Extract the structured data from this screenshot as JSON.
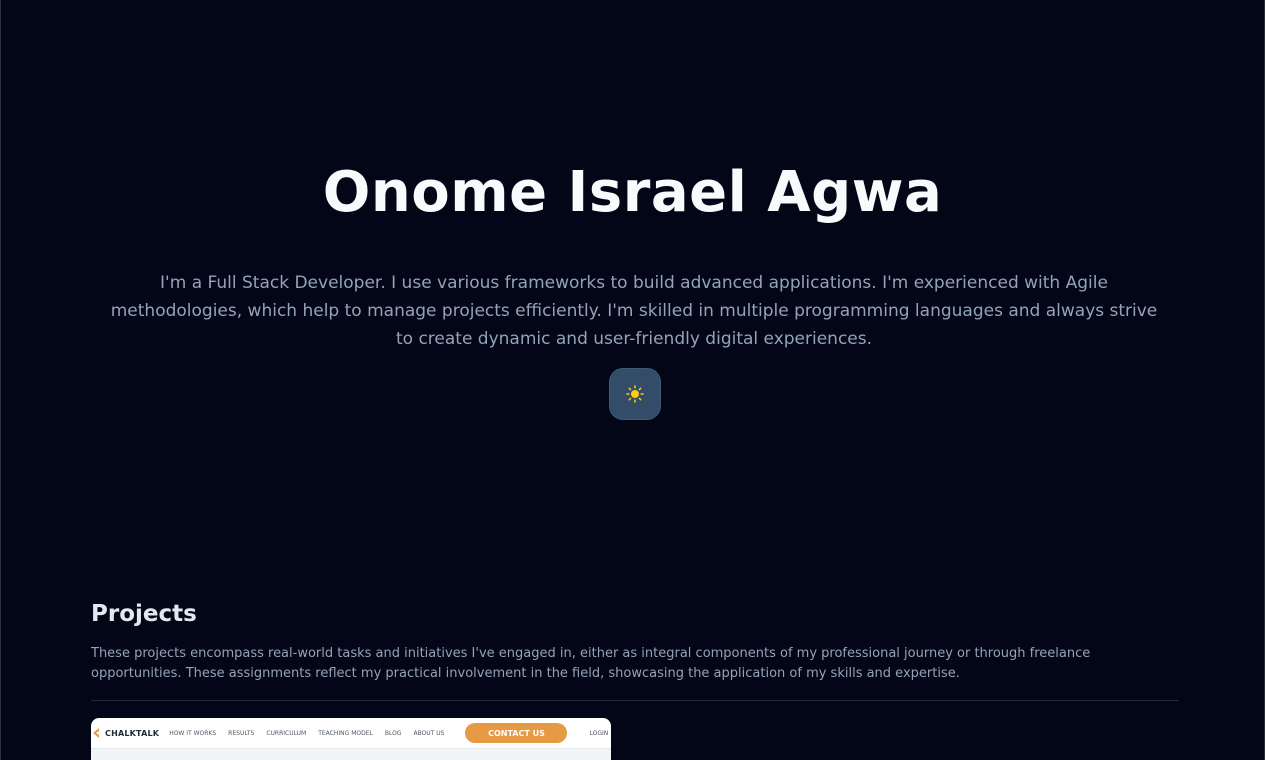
{
  "hero": {
    "name": "Onome Israel Agwa",
    "description": "I'm a Full Stack Developer. I use various frameworks to build advanced applications. I'm experienced with Agile methodologies, which help to manage projects efficiently. I'm skilled in multiple programming languages and always strive to create dynamic and user-friendly digital experiences."
  },
  "theme_toggle": {
    "icon": "sun-icon",
    "icon_color": "#facc15"
  },
  "projects": {
    "title": "Projects",
    "description": "These projects encompass real-world tasks and initiatives I've engaged in, either as integral components of my professional journey or through freelance opportunities. These assignments reflect my practical involvement in the field, showcasing the application of my skills and expertise.",
    "cards": [
      {
        "preview": {
          "logo": "CHALKTALK",
          "nav": [
            "HOW IT WORKS",
            "RESULTS",
            "CURRICULUM",
            "TEACHING MODEL",
            "BLOG",
            "ABOUT US"
          ],
          "cta": "CONTACT US",
          "login": "LOGIN",
          "accent": "#e69a43"
        }
      }
    ]
  },
  "colors": {
    "background": "#020617",
    "heading": "#f8fafc",
    "text_muted": "#94a3b8",
    "toggle_bg": "#334c68"
  }
}
